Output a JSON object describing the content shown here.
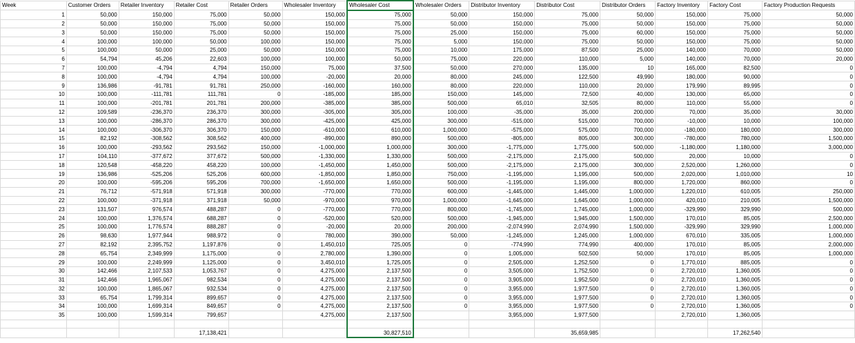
{
  "headers": [
    "Week",
    "Customer Orders",
    "Retailer Inventory",
    "Retailer Cost",
    "Retailer Orders",
    "Wholesaler Inventory",
    "Wholesaler Cost",
    "Wholesaler Orders",
    "Distributor Inventory",
    "Distributor Cost",
    "Distributor Orders",
    "Factory Inventory",
    "Factory Cost",
    "Factory Production Requests"
  ],
  "rows": [
    [
      "1",
      "50,000",
      "150,000",
      "75,000",
      "50,000",
      "150,000",
      "75,000",
      "50,000",
      "150,000",
      "75,000",
      "50,000",
      "150,000",
      "75,000",
      "50,000"
    ],
    [
      "2",
      "50,000",
      "150,000",
      "75,000",
      "50,000",
      "150,000",
      "75,000",
      "50,000",
      "150,000",
      "75,000",
      "50,000",
      "150,000",
      "75,000",
      "50,000"
    ],
    [
      "3",
      "50,000",
      "150,000",
      "75,000",
      "50,000",
      "150,000",
      "75,000",
      "25,000",
      "150,000",
      "75,000",
      "60,000",
      "150,000",
      "75,000",
      "50,000"
    ],
    [
      "4",
      "100,000",
      "100,000",
      "50,000",
      "100,000",
      "150,000",
      "75,000",
      "5,000",
      "150,000",
      "75,000",
      "50,000",
      "150,000",
      "75,000",
      "50,000"
    ],
    [
      "5",
      "100,000",
      "50,000",
      "25,000",
      "50,000",
      "150,000",
      "75,000",
      "10,000",
      "175,000",
      "87,500",
      "25,000",
      "140,000",
      "70,000",
      "50,000"
    ],
    [
      "6",
      "54,794",
      "45,206",
      "22,603",
      "100,000",
      "100,000",
      "50,000",
      "75,000",
      "220,000",
      "110,000",
      "5,000",
      "140,000",
      "70,000",
      "20,000"
    ],
    [
      "7",
      "100,000",
      "-4,794",
      "4,794",
      "150,000",
      "75,000",
      "37,500",
      "50,000",
      "270,000",
      "135,000",
      "10",
      "165,000",
      "82,500",
      "0"
    ],
    [
      "8",
      "100,000",
      "-4,794",
      "4,794",
      "100,000",
      "-20,000",
      "20,000",
      "80,000",
      "245,000",
      "122,500",
      "49,990",
      "180,000",
      "90,000",
      "0"
    ],
    [
      "9",
      "136,986",
      "-91,781",
      "91,781",
      "250,000",
      "-160,000",
      "160,000",
      "80,000",
      "220,000",
      "110,000",
      "20,000",
      "179,990",
      "89,995",
      "0"
    ],
    [
      "10",
      "100,000",
      "-111,781",
      "111,781",
      "0",
      "-185,000",
      "185,000",
      "150,000",
      "145,000",
      "72,500",
      "40,000",
      "130,000",
      "65,000",
      "0"
    ],
    [
      "11",
      "100,000",
      "-201,781",
      "201,781",
      "200,000",
      "-385,000",
      "385,000",
      "500,000",
      "65,010",
      "32,505",
      "80,000",
      "110,000",
      "55,000",
      "0"
    ],
    [
      "12",
      "109,589",
      "-236,370",
      "236,370",
      "300,000",
      "-305,000",
      "305,000",
      "100,000",
      "-35,000",
      "35,000",
      "200,000",
      "70,000",
      "35,000",
      "30,000"
    ],
    [
      "13",
      "100,000",
      "-286,370",
      "286,370",
      "300,000",
      "-425,000",
      "425,000",
      "300,000",
      "-515,000",
      "515,000",
      "700,000",
      "-10,000",
      "10,000",
      "100,000"
    ],
    [
      "14",
      "100,000",
      "-306,370",
      "306,370",
      "150,000",
      "-610,000",
      "610,000",
      "1,000,000",
      "-575,000",
      "575,000",
      "700,000",
      "-180,000",
      "180,000",
      "300,000"
    ],
    [
      "15",
      "82,192",
      "-308,562",
      "308,562",
      "400,000",
      "-890,000",
      "890,000",
      "500,000",
      "-805,000",
      "805,000",
      "300,000",
      "-780,000",
      "780,000",
      "1,500,000"
    ],
    [
      "16",
      "100,000",
      "-293,562",
      "293,562",
      "150,000",
      "-1,000,000",
      "1,000,000",
      "300,000",
      "-1,775,000",
      "1,775,000",
      "500,000",
      "-1,180,000",
      "1,180,000",
      "3,000,000"
    ],
    [
      "17",
      "104,110",
      "-377,672",
      "377,672",
      "500,000",
      "-1,330,000",
      "1,330,000",
      "500,000",
      "-2,175,000",
      "2,175,000",
      "500,000",
      "20,000",
      "10,000",
      "0"
    ],
    [
      "18",
      "120,548",
      "-458,220",
      "458,220",
      "100,000",
      "-1,450,000",
      "1,450,000",
      "500,000",
      "-2,175,000",
      "2,175,000",
      "300,000",
      "2,520,000",
      "1,260,000",
      "0"
    ],
    [
      "19",
      "136,986",
      "-525,206",
      "525,206",
      "600,000",
      "-1,850,000",
      "1,850,000",
      "750,000",
      "-1,195,000",
      "1,195,000",
      "500,000",
      "2,020,000",
      "1,010,000",
      "10"
    ],
    [
      "20",
      "100,000",
      "-595,206",
      "595,206",
      "700,000",
      "-1,650,000",
      "1,650,000",
      "500,000",
      "-1,195,000",
      "1,195,000",
      "800,000",
      "1,720,000",
      "860,000",
      "0"
    ],
    [
      "21",
      "76,712",
      "-571,918",
      "571,918",
      "300,000",
      "-770,000",
      "770,000",
      "600,000",
      "-1,445,000",
      "1,445,000",
      "1,000,000",
      "1,220,010",
      "610,005",
      "250,000"
    ],
    [
      "22",
      "100,000",
      "-371,918",
      "371,918",
      "50,000",
      "-970,000",
      "970,000",
      "1,000,000",
      "-1,645,000",
      "1,645,000",
      "1,000,000",
      "420,010",
      "210,005",
      "1,500,000"
    ],
    [
      "23",
      "131,507",
      "976,574",
      "488,287",
      "0",
      "-770,000",
      "770,000",
      "800,000",
      "-1,745,000",
      "1,745,000",
      "1,000,000",
      "-329,990",
      "329,990",
      "500,000"
    ],
    [
      "24",
      "100,000",
      "1,376,574",
      "688,287",
      "0",
      "-520,000",
      "520,000",
      "500,000",
      "-1,945,000",
      "1,945,000",
      "1,500,000",
      "170,010",
      "85,005",
      "2,500,000"
    ],
    [
      "25",
      "100,000",
      "1,776,574",
      "888,287",
      "0",
      "-20,000",
      "20,000",
      "200,000",
      "-2,074,990",
      "2,074,990",
      "1,500,000",
      "-329,990",
      "329,990",
      "1,000,000"
    ],
    [
      "26",
      "98,630",
      "1,977,944",
      "988,972",
      "0",
      "780,000",
      "390,000",
      "50,000",
      "-1,245,000",
      "1,245,000",
      "1,000,000",
      "670,010",
      "335,005",
      "1,000,000"
    ],
    [
      "27",
      "82,192",
      "2,395,752",
      "1,197,876",
      "0",
      "1,450,010",
      "725,005",
      "0",
      "-774,990",
      "774,990",
      "400,000",
      "170,010",
      "85,005",
      "2,000,000"
    ],
    [
      "28",
      "65,754",
      "2,349,999",
      "1,175,000",
      "0",
      "2,780,000",
      "1,390,000",
      "0",
      "1,005,000",
      "502,500",
      "50,000",
      "170,010",
      "85,005",
      "1,000,000"
    ],
    [
      "29",
      "100,000",
      "2,249,999",
      "1,125,000",
      "0",
      "3,450,010",
      "1,725,005",
      "0",
      "2,505,000",
      "1,252,500",
      "0",
      "1,770,010",
      "885,005",
      "0"
    ],
    [
      "30",
      "142,466",
      "2,107,533",
      "1,053,767",
      "0",
      "4,275,000",
      "2,137,500",
      "0",
      "3,505,000",
      "1,752,500",
      "0",
      "2,720,010",
      "1,360,005",
      "0"
    ],
    [
      "31",
      "142,466",
      "1,965,067",
      "982,534",
      "0",
      "4,275,000",
      "2,137,500",
      "0",
      "3,905,000",
      "1,952,500",
      "0",
      "2,720,010",
      "1,360,005",
      "0"
    ],
    [
      "32",
      "100,000",
      "1,865,067",
      "932,534",
      "0",
      "4,275,000",
      "2,137,500",
      "0",
      "3,955,000",
      "1,977,500",
      "0",
      "2,720,010",
      "1,360,005",
      "0"
    ],
    [
      "33",
      "65,754",
      "1,799,314",
      "899,657",
      "0",
      "4,275,000",
      "2,137,500",
      "0",
      "3,955,000",
      "1,977,500",
      "0",
      "2,720,010",
      "1,360,005",
      "0"
    ],
    [
      "34",
      "100,000",
      "1,699,314",
      "849,657",
      "0",
      "4,275,000",
      "2,137,500",
      "0",
      "3,955,000",
      "1,977,500",
      "0",
      "2,720,010",
      "1,360,005",
      "0"
    ],
    [
      "35",
      "100,000",
      "1,599,314",
      "799,657",
      "",
      "4,275,000",
      "2,137,500",
      "",
      "3,955,000",
      "1,977,500",
      "",
      "2,720,010",
      "1,360,005",
      ""
    ]
  ],
  "totals": [
    "",
    "",
    "",
    "17,138,421",
    "",
    "",
    "30,827,510",
    "",
    "",
    "35,659,985",
    "",
    "",
    "17,262,540",
    ""
  ],
  "selected_column_index": 6,
  "colors": {
    "grid": "#d9d9d9",
    "selection": "#1f7a3d"
  }
}
